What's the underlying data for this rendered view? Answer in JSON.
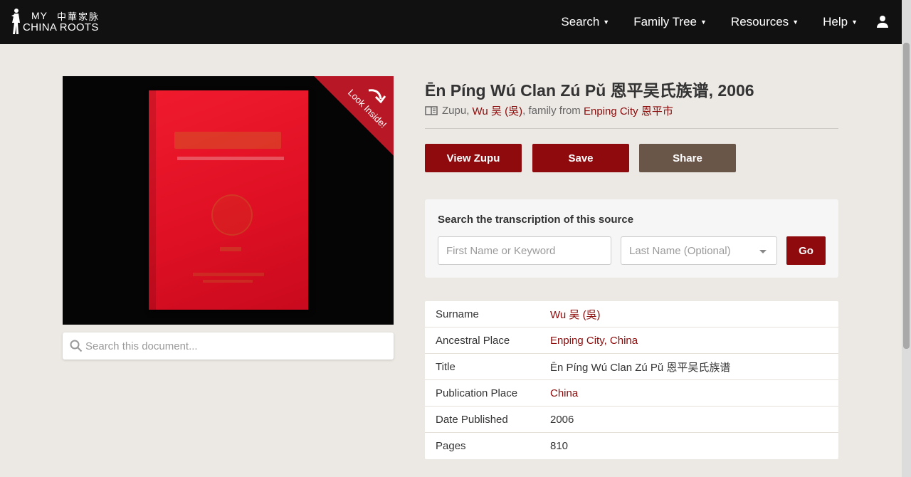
{
  "header": {
    "logo": {
      "my": "MY",
      "chinese": "中華家脉",
      "china_roots": "CHINA ROOTS"
    },
    "nav": [
      {
        "label": "Search"
      },
      {
        "label": "Family Tree"
      },
      {
        "label": "Resources"
      },
      {
        "label": "Help"
      }
    ]
  },
  "book_image": {
    "look_inside": "Look Inside!"
  },
  "doc_search": {
    "placeholder": "Search this document..."
  },
  "source": {
    "title": "Ēn Píng Wú Clan Zú Pǔ 恩平吴氏族谱, 2006",
    "type": "Zupu",
    "surname_link": "Wu 吴 (吳)",
    "family_from_text": "family from",
    "place_link": "Enping City 恩平市"
  },
  "actions": {
    "view": "View Zupu",
    "save": "Save",
    "share": "Share"
  },
  "transcription_search": {
    "label": "Search the transcription of this source",
    "first_placeholder": "First Name or Keyword",
    "last_placeholder": "Last Name (Optional)",
    "go": "Go"
  },
  "details": [
    {
      "label": "Surname",
      "value": "Wu 吴 (吳)",
      "link": true
    },
    {
      "label": "Ancestral Place",
      "value": "Enping City, China",
      "link": true
    },
    {
      "label": "Title",
      "value": "Ēn Píng Wú Clan Zú Pǔ 恩平吴氏族谱",
      "link": false
    },
    {
      "label": "Publication Place",
      "value": "China",
      "link": true
    },
    {
      "label": "Date Published",
      "value": "2006",
      "link": false
    },
    {
      "label": "Pages",
      "value": "810",
      "link": false
    }
  ],
  "colors": {
    "accent_red": "#8f0a0d",
    "share_brown": "#6a5549",
    "link_red": "#8b0a0a",
    "background": "#ece8e3"
  }
}
